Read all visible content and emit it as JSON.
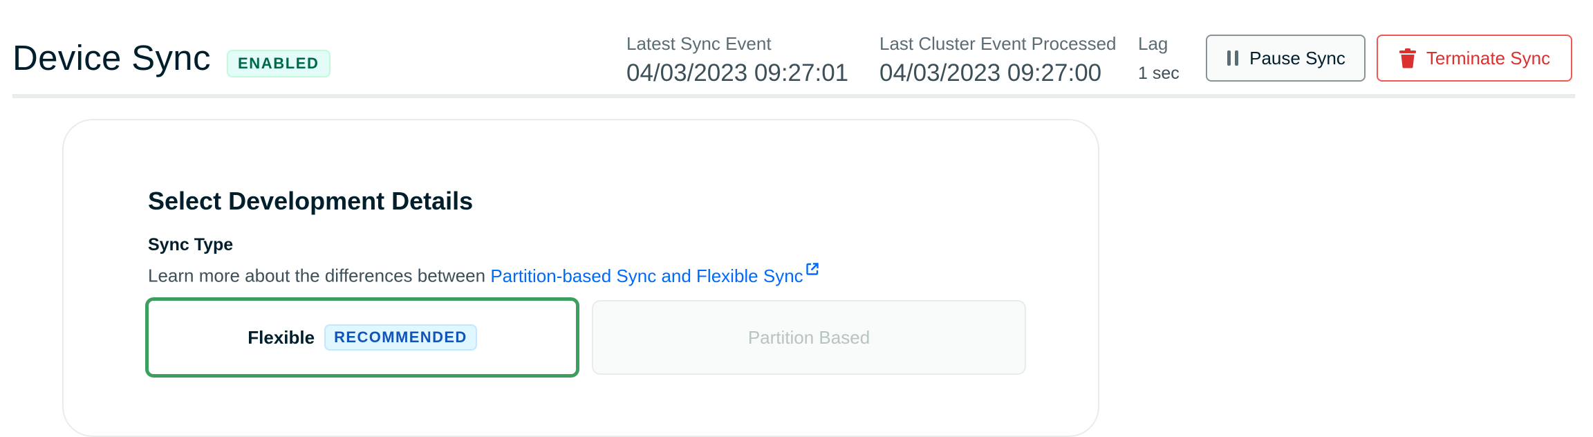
{
  "header": {
    "title": "Device Sync",
    "status_badge": "ENABLED",
    "stats": {
      "latest_sync_event": {
        "label": "Latest Sync Event",
        "value": "04/03/2023 09:27:01"
      },
      "last_cluster_event": {
        "label": "Last Cluster Event Processed",
        "value": "04/03/2023 09:27:00"
      },
      "lag": {
        "label": "Lag",
        "value": "1 sec"
      }
    },
    "buttons": {
      "pause": {
        "label": "Pause Sync",
        "icon": "pause-icon"
      },
      "terminate": {
        "label": "Terminate Sync",
        "icon": "trash-icon"
      }
    }
  },
  "card": {
    "section_title": "Select Development Details",
    "sync_type": {
      "label": "Sync Type",
      "description_prefix": "Learn more about the differences between",
      "link_text": "Partition-based Sync and Flexible Sync",
      "link_icon": "external-link-icon",
      "options": [
        {
          "label": "Flexible",
          "badge": "RECOMMENDED",
          "selected": true
        },
        {
          "label": "Partition Based",
          "selected": false,
          "disabled": true
        }
      ]
    }
  },
  "colors": {
    "text_primary": "#001e2b",
    "accent_green": "#3d9f5e",
    "danger_red": "#db3030",
    "link_blue": "#016bf8"
  }
}
